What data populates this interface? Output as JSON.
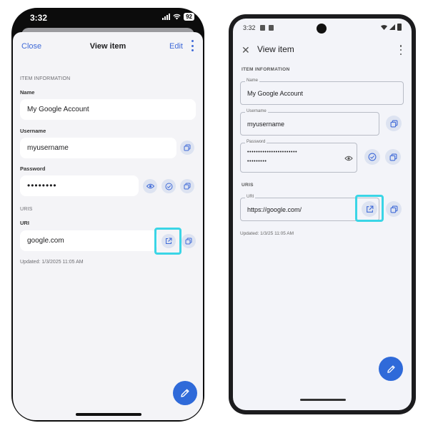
{
  "ios": {
    "status": {
      "time": "3:32",
      "battery": "92"
    },
    "nav": {
      "close": "Close",
      "title": "View item",
      "edit": "Edit"
    },
    "section_item_info": "ITEM INFORMATION",
    "name_label": "Name",
    "name_value": "My Google Account",
    "username_label": "Username",
    "username_value": "myusername",
    "password_label": "Password",
    "password_value": "••••••••",
    "section_uris": "URIS",
    "uri_label": "URI",
    "uri_value": "google.com",
    "updated": "Updated: 1/3/2025 11:05 AM"
  },
  "android": {
    "status": {
      "time": "3:32"
    },
    "nav": {
      "title": "View item"
    },
    "section_item_info": "ITEM INFORMATION",
    "name_label": "Name",
    "name_value": "My Google Account",
    "username_label": "Username",
    "username_value": "myusername",
    "password_label": "Password",
    "password_value_line1": "•••••••••••••••••••••••",
    "password_value_line2": "•••••••••",
    "section_uris": "URIS",
    "uri_label": "URI",
    "uri_value": "https://google.com/",
    "updated": "Updated: 1/3/25 11:05 AM"
  },
  "colors": {
    "accent": "#2f6ad9",
    "link": "#3f6ad8",
    "highlight": "#3ad5e6",
    "button_bg": "#dde3f1"
  },
  "icons": [
    "close-icon",
    "kebab-menu-icon",
    "copy-icon",
    "eye-icon",
    "check-circle-icon",
    "launch-icon",
    "pencil-icon"
  ]
}
